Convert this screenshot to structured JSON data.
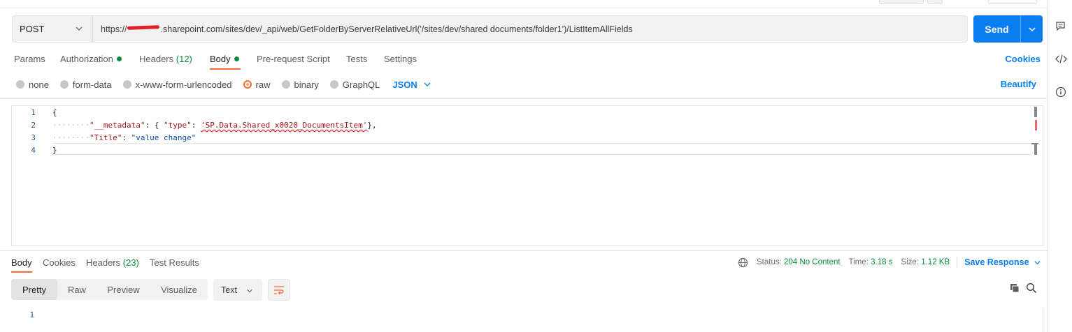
{
  "request": {
    "method": "POST",
    "url_visible": ".sharepoint.com/sites/dev/_api/web/GetFolderByServerRelativeUrl('/sites/dev/shared documents/folder1')/ListItemAllFields",
    "url_prefix": "https://",
    "send_label": "Send"
  },
  "request_tabs": [
    {
      "label": "Params"
    },
    {
      "label": "Authorization"
    },
    {
      "label": "Headers",
      "count": "(12)"
    },
    {
      "label": "Body"
    },
    {
      "label": "Pre-request Script"
    },
    {
      "label": "Tests"
    },
    {
      "label": "Settings"
    }
  ],
  "cookies_label": "Cookies",
  "body_modes": {
    "options": [
      "none",
      "form-data",
      "x-www-form-urlencoded",
      "raw",
      "binary",
      "GraphQL"
    ],
    "selected": "raw",
    "language": "JSON",
    "beautify_label": "Beautify"
  },
  "editor": {
    "line_numbers": [
      "1",
      "2",
      "3",
      "4"
    ],
    "lines": [
      {
        "indent": "",
        "parts": [
          {
            "t": "{",
            "c": "p"
          }
        ]
      },
      {
        "indent": "········",
        "parts": [
          {
            "t": "\"__metadata\"",
            "c": "k"
          },
          {
            "t": ": { ",
            "c": "p"
          },
          {
            "t": "\"type\"",
            "c": "k"
          },
          {
            "t": ": ",
            "c": "p"
          },
          {
            "t": "'SP.Data.Shared_x0020_DocumentsItem'",
            "c": "sq"
          },
          {
            "t": "},",
            "c": "p"
          }
        ]
      },
      {
        "indent": "········",
        "parts": [
          {
            "t": "\"Title\"",
            "c": "k"
          },
          {
            "t": ": ",
            "c": "p"
          },
          {
            "t": "\"value change\"",
            "c": "s"
          }
        ]
      },
      {
        "indent": "",
        "parts": [
          {
            "t": "}",
            "c": "p"
          }
        ]
      }
    ]
  },
  "response": {
    "tabs": [
      {
        "label": "Body"
      },
      {
        "label": "Cookies"
      },
      {
        "label": "Headers",
        "count": "(23)"
      },
      {
        "label": "Test Results"
      }
    ],
    "status_label": "Status:",
    "status_value": "204 No Content",
    "time_label": "Time:",
    "time_value": "3.18 s",
    "size_label": "Size:",
    "size_value": "1.12 KB",
    "save_label": "Save Response",
    "views": [
      "Pretty",
      "Raw",
      "Preview",
      "Visualize"
    ],
    "active_view": "Pretty",
    "format": "Text",
    "line_numbers": [
      "1"
    ]
  },
  "colors": {
    "accent": "#ff6c37",
    "primary": "#0a7ef0",
    "success": "#0a8a3c"
  },
  "icons": {
    "right_bar": [
      "comment-icon",
      "code-icon",
      "info-icon"
    ]
  }
}
